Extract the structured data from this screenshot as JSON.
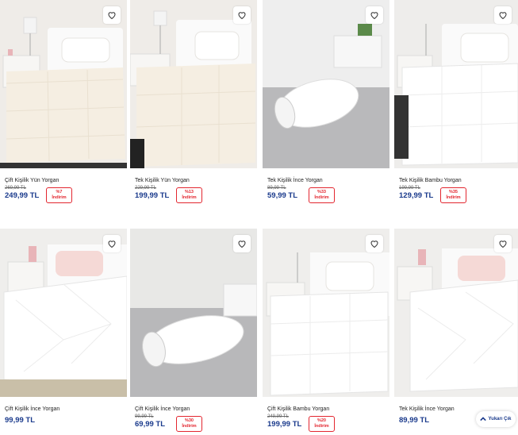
{
  "products": [
    {
      "name": "Çift Kişilik Yün Yorgan",
      "old_price": "269,99 TL",
      "price": "249,99 TL",
      "discount": "%7",
      "discount_label": "İndirim"
    },
    {
      "name": "Tek Kişilik Yün Yorgan",
      "old_price": "229,99 TL",
      "price": "199,99 TL",
      "discount": "%13",
      "discount_label": "İndirim"
    },
    {
      "name": "Tek Kişilik İnce Yorgan",
      "old_price": "89,99 TL",
      "price": "59,99 TL",
      "discount": "%33",
      "discount_label": "İndirim"
    },
    {
      "name": "Tek Kişilik Bambu Yorgan",
      "old_price": "199,99 TL",
      "price": "129,99 TL",
      "discount": "%35",
      "discount_label": "İndirim"
    },
    {
      "name": "Çift Kişilik İnce Yorgan",
      "price": "99,99 TL"
    },
    {
      "name": "Çift Kişilik İnce Yorgan",
      "old_price": "99,99 TL",
      "price": "69,99 TL",
      "discount": "%30",
      "discount_label": "İndirim"
    },
    {
      "name": "Çift Kişilik Bambu Yorgan",
      "old_price": "249,99 TL",
      "price": "199,99 TL",
      "discount": "%20",
      "discount_label": "İndirim"
    },
    {
      "name": "Tek Kişilik İnce Yorgan",
      "price": "89,99 TL"
    }
  ],
  "scroll_top": {
    "label": "Yukarı Çık",
    "icon": "chevron-up-icon"
  },
  "colors": {
    "price": "#1a3a8c",
    "discount": "#e3262f"
  }
}
